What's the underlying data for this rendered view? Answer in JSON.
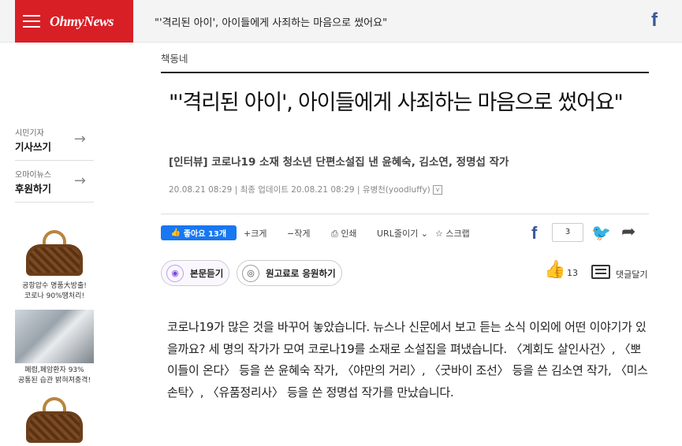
{
  "header": {
    "logo": "OhmyNews",
    "title": "\"'격리된 아이', 아이들에게 사죄하는 마음으로 썼어요\"",
    "facebook_icon": "facebook-icon"
  },
  "sidebar": {
    "links": [
      {
        "sub": "시민기자",
        "main": "기사쓰기",
        "arrow": "→"
      },
      {
        "sub": "오마이뉴스",
        "main": "후원하기",
        "arrow": "→"
      }
    ],
    "ads": [
      {
        "caption_line1": "공항압수 명품大방출!",
        "caption_line2": "코로나 90%땡처리!"
      },
      {
        "caption_line1": "폐렴,폐암환자 93%",
        "caption_line2": "공통된 습관 밝혀져충격!"
      }
    ]
  },
  "article": {
    "section": "책동네",
    "headline": "\"'격리된 아이', 아이들에게 사죄하는 마음으로 썼어요\"",
    "subhead": "[인터뷰] 코로나19 소재 청소년 단편소설집 낸 윤혜숙, 김소연, 정명섭 작가",
    "meta": {
      "date": "20.08.21 08:29",
      "separator": "|",
      "update_label": "최종 업데이트 20.08.21 08:29",
      "author": "유병천(yoodluffy)",
      "caret": "v"
    },
    "toolbar": {
      "like": "좋아요 13개",
      "font_up": "+크게",
      "font_down": "−작게",
      "print": "인쇄",
      "url_shorten": "URL줄이기",
      "scrap": "스크랩",
      "share_count": "3"
    },
    "actions": {
      "listen": "본문듣기",
      "support": "원고료로 응원하기",
      "likes_count": "13",
      "comment": "댓글달기"
    },
    "body": "코로나19가 많은 것을 바꾸어 놓았습니다. 뉴스나 신문에서 보고 듣는 소식 이외에 어떤 이야기가 있을까요? 세 명의 작가가 모여 코로나19를 소재로 소설집을 펴냈습니다. 〈계회도 살인사건〉, 〈뽀이들이 온다〉 등을 쓴 윤혜숙 작가, 〈야만의 거리〉, 〈굿바이 조선〉 등을 쓴 김소연 작가, 〈미스 손탁〉, 〈유품정리사〉 등을 쓴 정명섭 작가를 만났습니다."
  }
}
